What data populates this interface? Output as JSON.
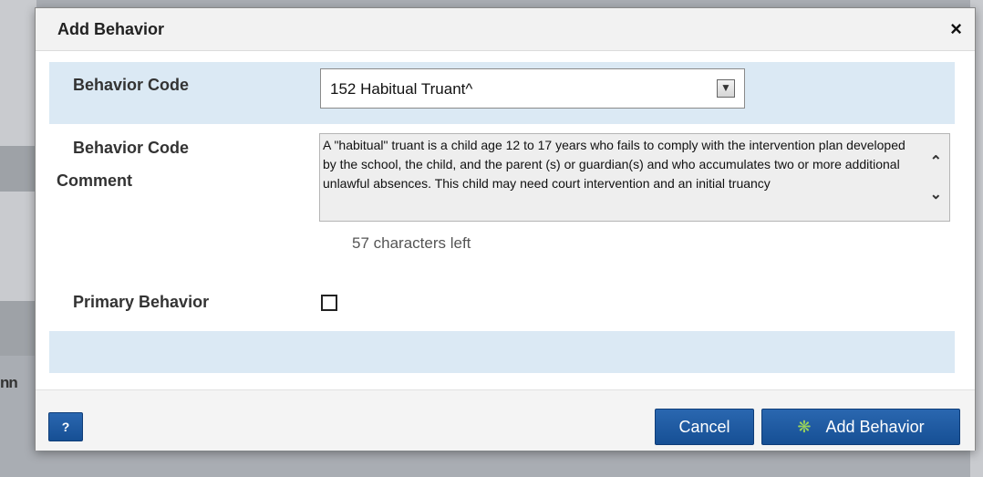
{
  "background": {
    "left_text": "nn"
  },
  "dialog": {
    "title": "Add Behavior",
    "close_glyph": "×",
    "behavior_code": {
      "label": "Behavior Code",
      "selected": "152 Habitual Truant^"
    },
    "comment": {
      "label_line1": "Behavior Code",
      "label_line2": "Comment",
      "text": "A \"habitual\" truant is a child age 12 to 17 years who fails to comply with the intervention plan developed by the school, the child, and the parent (s) or guardian(s) and who accumulates two or more additional unlawful absences. This child may need court intervention and an initial truancy",
      "chars_left": "57 characters left"
    },
    "primary_behavior": {
      "label": "Primary Behavior",
      "checked": false
    },
    "footer": {
      "help_label": "?",
      "cancel_label": "Cancel",
      "add_label": "Add Behavior"
    }
  },
  "icons": {
    "close": "close-icon",
    "dropdown": "chevron-down-icon",
    "scroll_up": "chevron-up-icon",
    "scroll_down": "chevron-down-icon",
    "add": "gear-icon"
  },
  "colors": {
    "row_shade": "#dbe9f4",
    "button_blue": "#1d5aa3",
    "title_bar": "#f2f2f2"
  }
}
